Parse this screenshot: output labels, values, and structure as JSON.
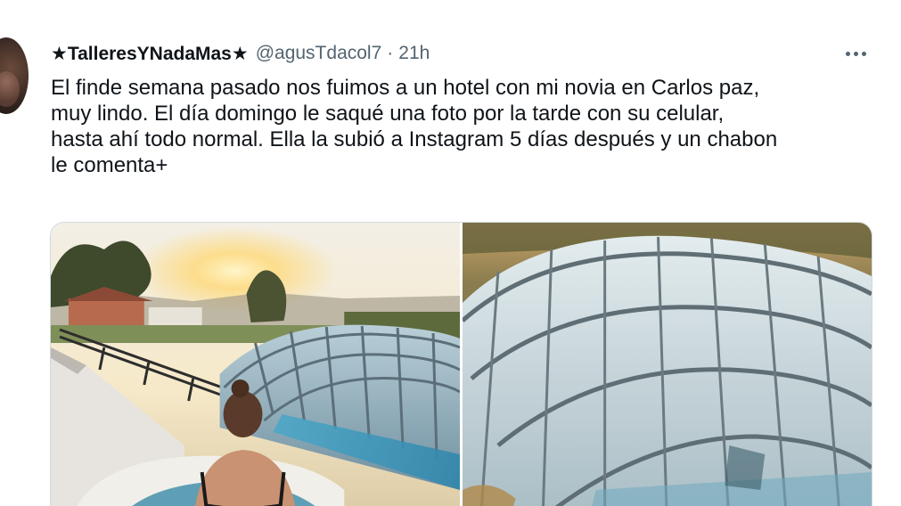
{
  "tweet": {
    "display_name": "★TalleresYNadaMas★",
    "handle": "@agusTdacol7",
    "separator": "·",
    "timestamp": "21h",
    "text": "El finde semana pasado nos fuimos a un hotel con mi novia en Carlos paz,\nmuy lindo. El día domingo le saqué una foto por la tarde con su celular,\nhasta ahí todo normal. Ella la subió a Instagram 5 días después y un chabon\nle comenta+",
    "more_icon": "more-horizontal-icon",
    "media": [
      {
        "description_icon": "photo-sunset-pool"
      },
      {
        "description_icon": "photo-pool-dome"
      }
    ]
  },
  "colors": {
    "text_primary": "#0f1419",
    "text_secondary": "#536471",
    "border": "#cfd9de",
    "background": "#ffffff"
  }
}
